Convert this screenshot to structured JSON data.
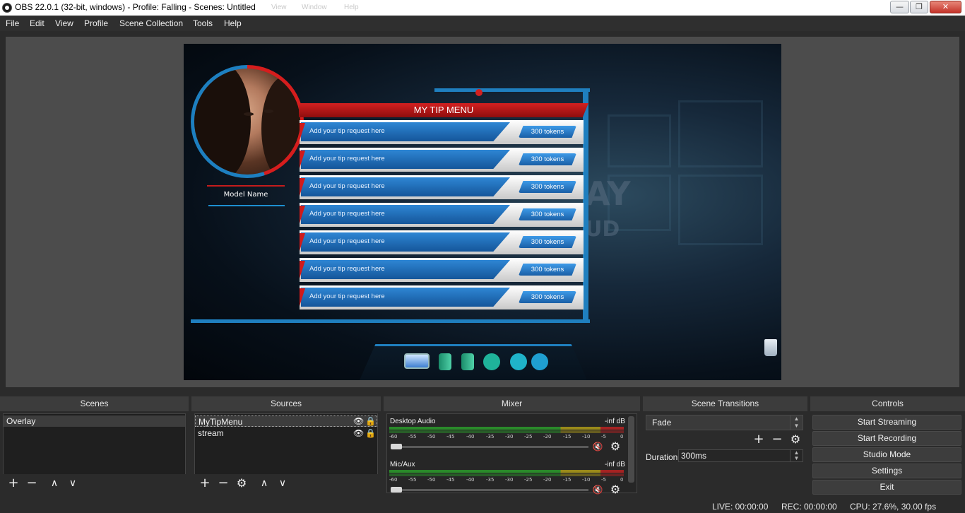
{
  "window": {
    "title": "OBS 22.0.1 (32-bit, windows) - Profile: Falling - Scenes: Untitled",
    "ghost_menu": [
      "View",
      "Window",
      "Help"
    ],
    "minimize": "—",
    "maximize": "❐",
    "close": "✕"
  },
  "menu": [
    "File",
    "Edit",
    "View",
    "Profile",
    "Scene Collection",
    "Tools",
    "Help"
  ],
  "preview": {
    "tip_menu_title": "MY TIP MENU",
    "model_name": "Model Name",
    "bg_text_1": "AY",
    "bg_text_2": "UD",
    "tip_rows": [
      {
        "request": "Add your tip request here",
        "tokens": "300 tokens"
      },
      {
        "request": "Add your tip request here",
        "tokens": "300 tokens"
      },
      {
        "request": "Add your tip request here",
        "tokens": "300 tokens"
      },
      {
        "request": "Add your tip request here",
        "tokens": "300 tokens"
      },
      {
        "request": "Add your tip request here",
        "tokens": "300 tokens"
      },
      {
        "request": "Add your tip request here",
        "tokens": "300 tokens"
      },
      {
        "request": "Add your tip request here",
        "tokens": "300 tokens"
      }
    ],
    "dock_icons": [
      "monitor-icon",
      "book-icon",
      "book-icon",
      "headphones-icon",
      "document-icon",
      "chrome-icon"
    ]
  },
  "panels": {
    "scenes": {
      "header": "Scenes",
      "items": [
        "Overlay"
      ]
    },
    "sources": {
      "header": "Sources",
      "items": [
        "MyTipMenu",
        "stream"
      ]
    },
    "mixer": {
      "header": "Mixer",
      "channels": [
        {
          "name": "Desktop Audio",
          "db": "-inf dB"
        },
        {
          "name": "Mic/Aux",
          "db": "-inf dB"
        }
      ],
      "ticks": [
        "-60",
        "-55",
        "-50",
        "-45",
        "-40",
        "-35",
        "-30",
        "-25",
        "-20",
        "-15",
        "-10",
        "-5",
        "0"
      ]
    },
    "transitions": {
      "header": "Scene Transitions",
      "selected": "Fade",
      "duration_label": "Duration",
      "duration_value": "300ms"
    },
    "controls": {
      "header": "Controls",
      "buttons": [
        "Start Streaming",
        "Start Recording",
        "Studio Mode",
        "Settings",
        "Exit"
      ]
    }
  },
  "toolbar_glyphs": {
    "add": "+",
    "remove": "−",
    "up": "∧",
    "down": "∨",
    "gear": "⚙",
    "eye": "👁",
    "lock": "🔒",
    "mute": "🔇"
  },
  "status": {
    "live": "LIVE: 00:00:00",
    "rec": "REC: 00:00:00",
    "cpu": "CPU: 27.6%, 30.00 fps"
  }
}
